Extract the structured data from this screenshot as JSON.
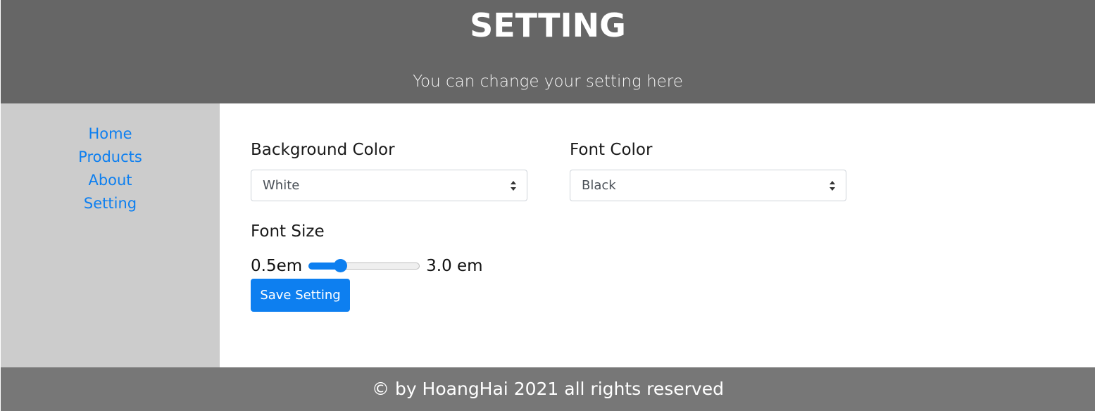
{
  "header": {
    "title": "SETTING",
    "subtitle": "You can change your setting here"
  },
  "sidebar": {
    "items": [
      {
        "label": "Home"
      },
      {
        "label": "Products"
      },
      {
        "label": "About"
      },
      {
        "label": "Setting"
      }
    ]
  },
  "form": {
    "background_color": {
      "label": "Background Color",
      "value": "White"
    },
    "font_color": {
      "label": "Font Color",
      "value": "Black"
    },
    "font_size": {
      "label": "Font Size",
      "min_label": "0.5em",
      "max_label": "3.0 em",
      "min": 0.5,
      "max": 3.0,
      "value": 1.2
    },
    "save_label": "Save Setting"
  },
  "footer": {
    "text": "© by HoangHai 2021 all rights reserved"
  },
  "colors": {
    "header_bg": "#666666",
    "sidebar_bg": "#cccccc",
    "footer_bg": "#777777",
    "accent": "#0d7ff0",
    "link": "#0d7ff0"
  },
  "icons": {
    "select_arrow": "sort-arrows-icon"
  }
}
